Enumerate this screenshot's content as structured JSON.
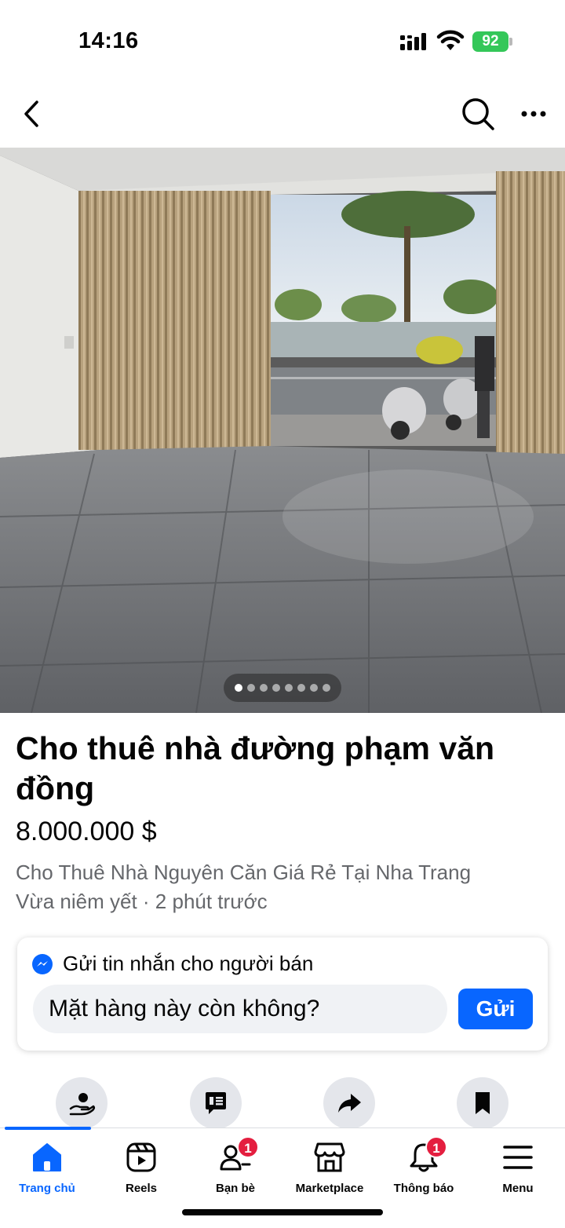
{
  "status_bar": {
    "time": "14:16",
    "battery": "92"
  },
  "nav": {
    "back_icon": "chevron-left-icon",
    "search_icon": "search-icon",
    "more_icon": "more-horizontal-icon"
  },
  "gallery": {
    "total_photos": 8,
    "current_index": 1
  },
  "listing": {
    "title": "Cho thuê nhà đường phạm văn đồng",
    "price": "8.000.000 $",
    "subtitle": "Cho Thuê Nhà Nguyên Căn Giá Rẻ Tại Nha Trang",
    "meta": "Vừa niêm yết · 2 phút trước"
  },
  "message": {
    "header": "Gửi tin nhắn cho người bán",
    "input_value": "Mặt hàng này còn không?",
    "send_label": "Gửi"
  },
  "actions": [
    "offer-icon",
    "message-list-icon",
    "share-icon",
    "bookmark-icon"
  ],
  "tabs": [
    {
      "label": "Trang chủ",
      "icon": "home-icon",
      "active": true,
      "badge": ""
    },
    {
      "label": "Reels",
      "icon": "reels-icon",
      "active": false,
      "badge": ""
    },
    {
      "label": "Bạn bè",
      "icon": "friends-icon",
      "active": false,
      "badge": "1"
    },
    {
      "label": "Marketplace",
      "icon": "marketplace-icon",
      "active": false,
      "badge": ""
    },
    {
      "label": "Thông báo",
      "icon": "bell-icon",
      "active": false,
      "badge": "1"
    },
    {
      "label": "Menu",
      "icon": "menu-icon",
      "active": false,
      "badge": ""
    }
  ],
  "colors": {
    "accent": "#0866ff",
    "badge": "#e41e3f",
    "battery": "#34c759",
    "secondary_text": "#65676b"
  }
}
